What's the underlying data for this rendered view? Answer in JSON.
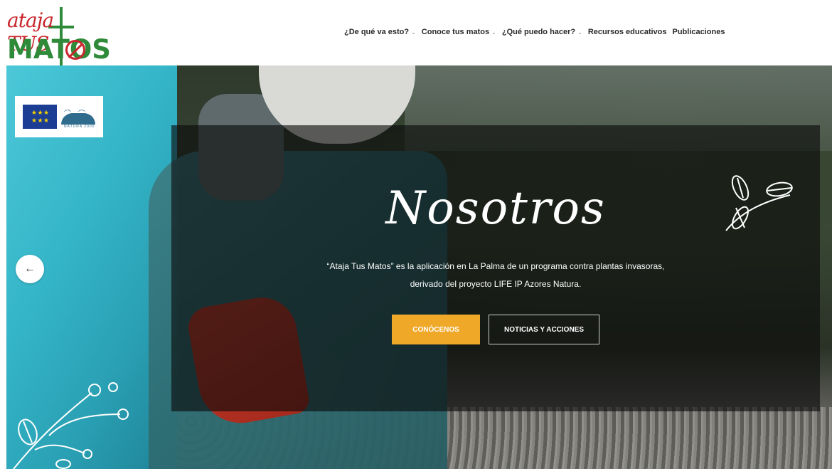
{
  "header": {
    "logo": {
      "top": "ataja TUS",
      "bottom": "MATOS"
    },
    "nav": [
      {
        "label": "¿De qué va esto?",
        "has_dropdown": true
      },
      {
        "label": "Conoce tus matos",
        "has_dropdown": true
      },
      {
        "label": "¿Qué puedo hacer?",
        "has_dropdown": true
      },
      {
        "label": "Recursos educativos",
        "has_dropdown": false
      },
      {
        "label": "Publicaciones",
        "has_dropdown": false
      }
    ]
  },
  "hero": {
    "badge": {
      "natura_text": "NATURA 2000"
    },
    "title": "Nosotros",
    "description_line1": "“Ataja Tus Matos” es la aplicación en La Palma de un programa contra plantas invasoras,",
    "description_line2": "derivado del proyecto LIFE IP Azores Natura.",
    "buttons": {
      "primary": "CONÓCENOS",
      "secondary": "NOTICIAS Y ACCIONES"
    },
    "prev_arrow": "←"
  },
  "colors": {
    "accent": "#f0a828",
    "logo_red": "#c8262c",
    "logo_green": "#2f8a3a",
    "overlay": "rgba(10,10,10,0.62)"
  }
}
